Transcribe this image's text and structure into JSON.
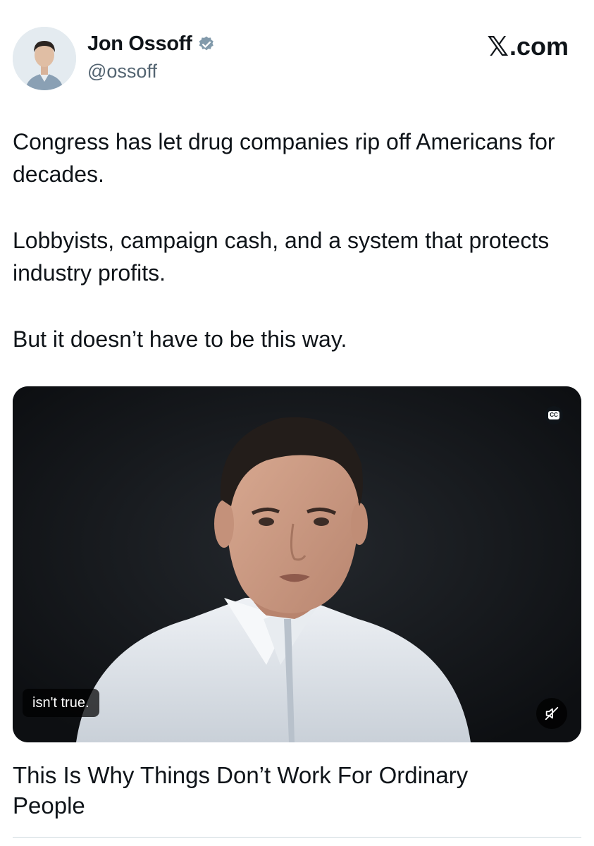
{
  "author": {
    "name": "Jon Ossoff",
    "handle": "@ossoff",
    "verified_color": "#829aab"
  },
  "site_label": ".com",
  "site_logo": "x-logo",
  "tweet": {
    "paragraphs": [
      "Congress has let drug companies rip off Americans for decades.",
      "Lobbyists, campaign cash, and a system that protects industry profits.",
      "But it doesn’t have to be this way."
    ]
  },
  "video": {
    "cc_label": "CC",
    "caption": "isn't true.",
    "mute_icon": "speaker-muted-icon"
  },
  "card": {
    "title": "This Is Why Things Don’t Work For Ordinary People"
  },
  "colors": {
    "text": "#0f1419",
    "secondary_text": "#536471",
    "video_bg": "#14161a"
  }
}
